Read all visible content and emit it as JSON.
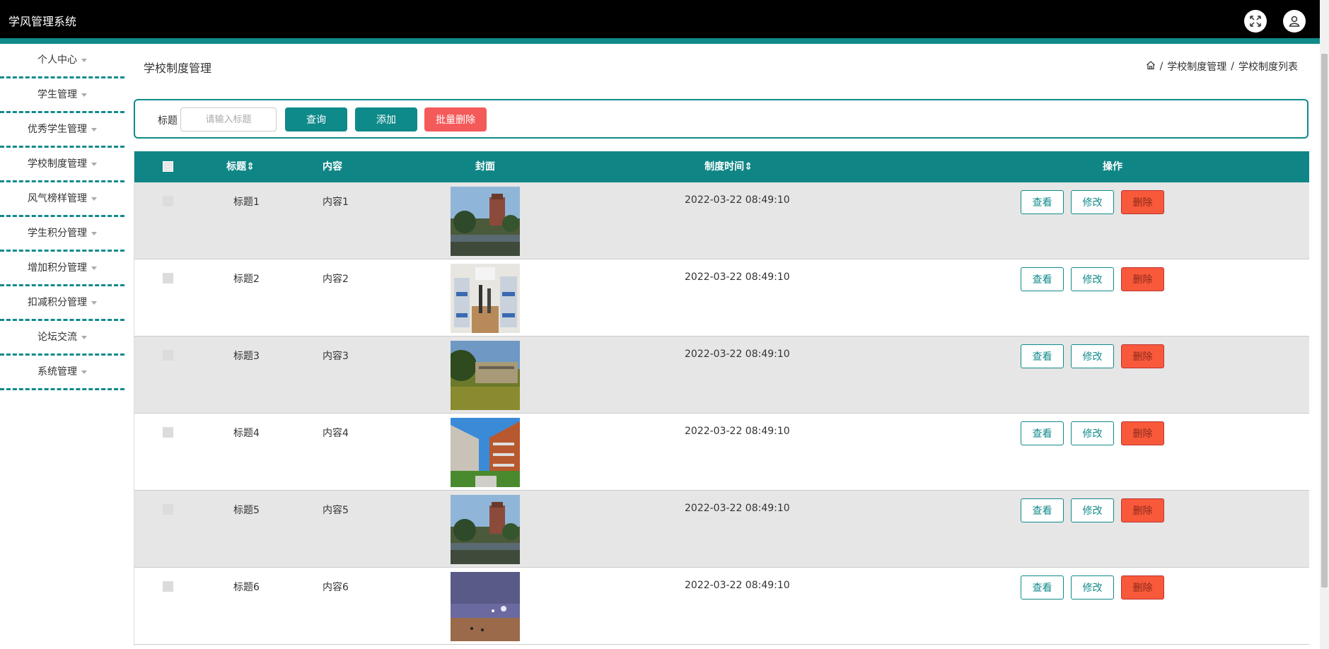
{
  "app": {
    "title": "学风管理系统"
  },
  "sidebar": {
    "items": [
      {
        "label": "个人中心"
      },
      {
        "label": "学生管理"
      },
      {
        "label": "优秀学生管理"
      },
      {
        "label": "学校制度管理"
      },
      {
        "label": "风气榜样管理"
      },
      {
        "label": "学生积分管理"
      },
      {
        "label": "增加积分管理"
      },
      {
        "label": "扣减积分管理"
      },
      {
        "label": "论坛交流"
      },
      {
        "label": "系统管理"
      }
    ]
  },
  "page": {
    "title": "学校制度管理",
    "breadcrumb": [
      "学校制度管理",
      "学校制度列表"
    ]
  },
  "search": {
    "label": "标题",
    "placeholder": "请输入标题",
    "query_label": "查询",
    "add_label": "添加",
    "batch_delete_label": "批量删除"
  },
  "table": {
    "headers": {
      "title": "标题",
      "content": "内容",
      "cover": "封面",
      "time": "制度时间",
      "actions": "操作"
    },
    "actions": {
      "view": "查看",
      "edit": "修改",
      "delete": "删除"
    },
    "rows": [
      {
        "title": "标题1",
        "content": "内容1",
        "time": "2022-03-22 08:49:10",
        "cover": "campus-lake"
      },
      {
        "title": "标题2",
        "content": "内容2",
        "time": "2022-03-22 08:49:10",
        "cover": "dormitory"
      },
      {
        "title": "标题3",
        "content": "内容3",
        "time": "2022-03-22 08:49:10",
        "cover": "campus-lawn"
      },
      {
        "title": "标题4",
        "content": "内容4",
        "time": "2022-03-22 08:49:10",
        "cover": "campus-building"
      },
      {
        "title": "标题5",
        "content": "内容5",
        "time": "2022-03-22 08:49:10",
        "cover": "campus-lake"
      },
      {
        "title": "标题6",
        "content": "内容6",
        "time": "2022-03-22 08:49:10",
        "cover": "night-field"
      }
    ]
  },
  "colors": {
    "accent": "#108a8a",
    "danger": "#f8593a",
    "batch_delete": "#f45a5a"
  }
}
